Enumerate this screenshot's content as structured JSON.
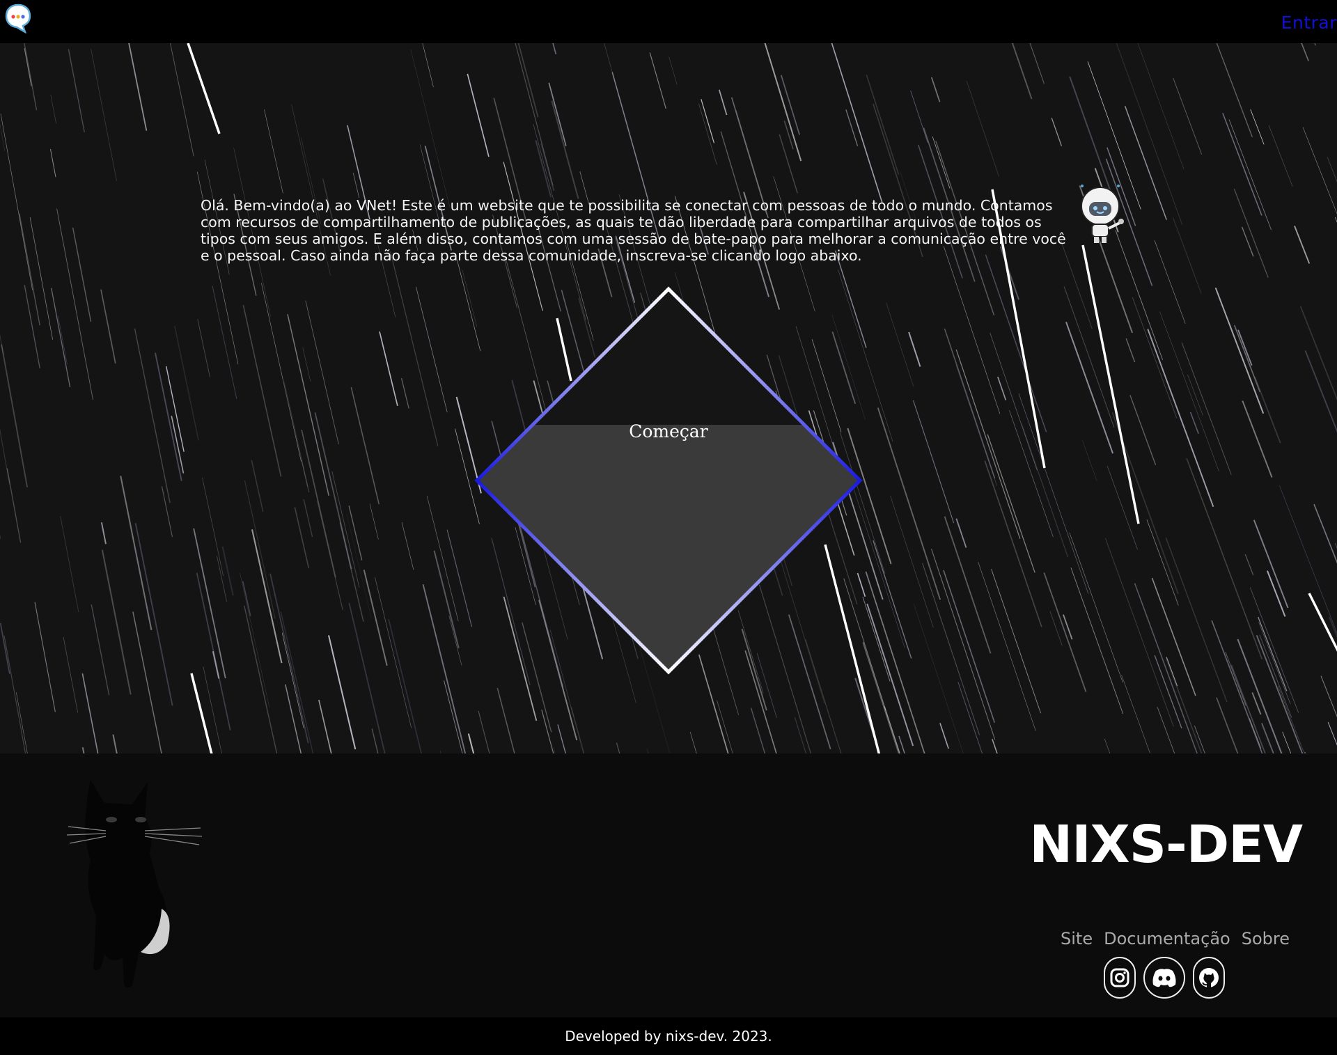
{
  "header": {
    "login_label": "Entrar"
  },
  "hero": {
    "intro_text": "Olá. Bem-vindo(a) ao VNet! Este é um website que te possibilita se conectar com pessoas de todo o mundo. Contamos com recursos de compartilhamento de publicações, as quais te dão liberdade para compartilhar arquivos de todos os tipos com seus amigos. E além disso, contamos com uma sessão de bate-papo para melhorar a comunicação entre você e o pessoal. Caso ainda não faça parte dessa comunidade, inscreva-se clicando logo abaixo.",
    "start_label": "Começar"
  },
  "footer": {
    "brand": "NIXS-DEV",
    "links": [
      "Site",
      "Documentação",
      "Sobre"
    ],
    "socials": [
      "instagram-icon",
      "discord-icon",
      "github-icon"
    ]
  },
  "bottom": {
    "credit": "Developed by nixs-dev. 2023."
  },
  "colors": {
    "accent": "#1010d8",
    "border_gradient_start": "#ffffff",
    "border_gradient_end": "#1a1ae0"
  }
}
